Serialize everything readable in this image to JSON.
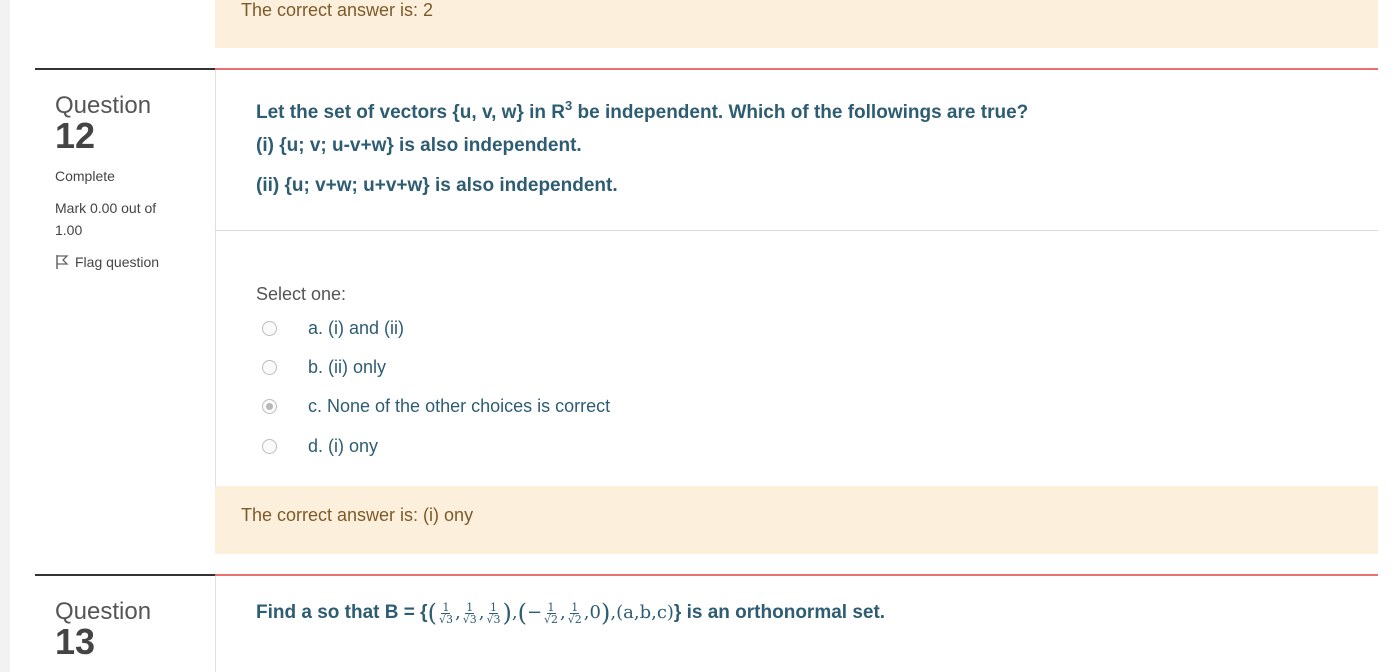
{
  "prev_feedback": {
    "text": "The correct answer is: 2"
  },
  "q12": {
    "label": "Question",
    "number": "12",
    "state": "Complete",
    "mark": "Mark 0.00 out of 1.00",
    "mark_line1": "Mark 0.00 out of",
    "mark_line2": "1.00",
    "flag_label": "Flag question",
    "text_line1_a": "Let the set of vectors {u, v, w} in R",
    "text_line1_sup": "3",
    "text_line1_b": " be independent. Which of the followings are true?",
    "text_line2": "(i) {u; v; u-v+w} is also independent.",
    "text_line3": "(ii) {u; v+w; u+v+w} is also independent.",
    "prompt": "Select one:",
    "options": [
      {
        "label": "a. (i) and (ii)",
        "selected": false
      },
      {
        "label": "b. (ii) only",
        "selected": false
      },
      {
        "label": "c. None of the other choices is correct",
        "selected": true
      },
      {
        "label": "d. (i) ony",
        "selected": false
      }
    ],
    "feedback": "The correct answer is: (i) ony"
  },
  "q13": {
    "label": "Question",
    "number": "13",
    "text_prefix": "Find a so that B = {",
    "text_suffix": "} is an orthonormal set.",
    "math": {
      "one": "1",
      "sqrt3": "√3",
      "sqrt2": "√2",
      "open": "(",
      "close": ")",
      "comma": ",",
      "neg": "−",
      "zero": "0",
      "abc": "(a,b,c)"
    }
  },
  "colors": {
    "question_text": "#2d5c73",
    "feedback_bg": "#fcefdc",
    "feedback_text": "#7d5a29",
    "accent_rule": "#e8706f"
  }
}
